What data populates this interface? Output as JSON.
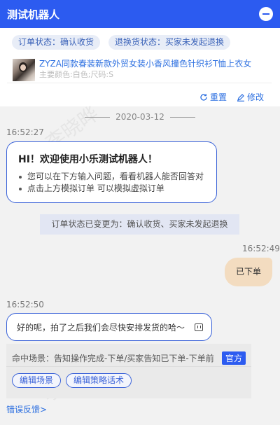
{
  "header": {
    "title": "测试机器人",
    "collapse_icon": "minus-circle-icon"
  },
  "order": {
    "status_labels": [
      "订单状态：确认收货",
      "退换货状态：买家未发起退换"
    ],
    "product": {
      "name": "ZYZA同款春装新款外贸女装小香风撞色针织衫T恤上衣女",
      "spec": "主要颜色:白色;尺码:S"
    },
    "actions": {
      "reset": "重置",
      "modify": "修改"
    }
  },
  "chat": {
    "date": "2020-03-12",
    "welcome_time": "16:52:27",
    "welcome": {
      "title": "HI！欢迎使用小乐测试机器人！",
      "items": [
        "您可以在下方输入问题，看看机器人能否回答对",
        "点击上方模拟订单 可以模拟虚拟订单"
      ]
    },
    "system_message": "订单状态已变更为：确认收货、买家未发起退换",
    "user_time": "16:52:49",
    "user_message": "已下单",
    "bot_time": "16:52:50",
    "bot_message": "好的呢，拍了之后我们会尽快安排发货的哈～",
    "match": {
      "text": "命中场景：告知操作完成-下单/买家告知已下单-下单前",
      "badge": "官方",
      "edit_scene": "编辑场景",
      "edit_strategy": "编辑策略话术"
    },
    "error_feedback": "错误反馈>"
  },
  "watermark": "李晓晔"
}
